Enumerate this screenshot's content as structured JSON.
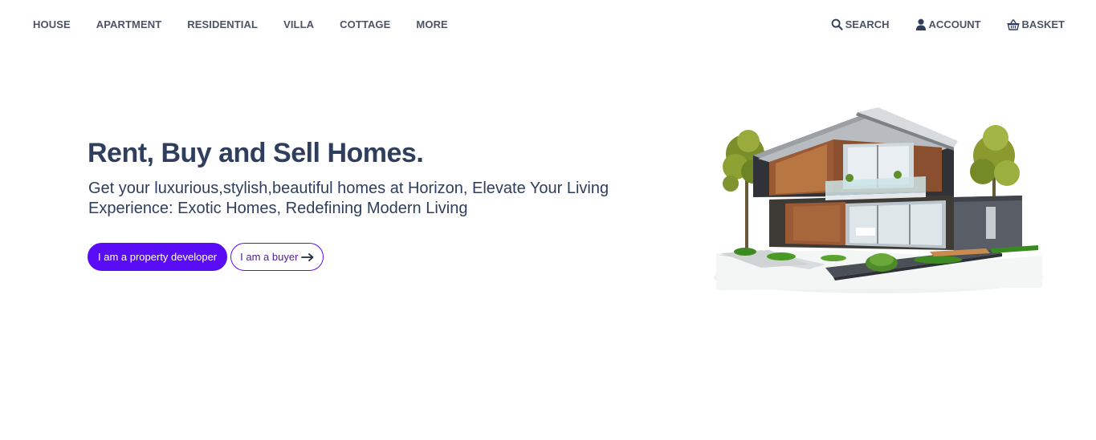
{
  "nav": {
    "links": [
      {
        "label": "HOUSE"
      },
      {
        "label": "APARTMENT"
      },
      {
        "label": "RESIDENTIAL"
      },
      {
        "label": "VILLA"
      },
      {
        "label": "COTTAGE"
      },
      {
        "label": "MORE"
      }
    ],
    "utilities": {
      "search": {
        "label": "SEARCH",
        "icon": "search-icon"
      },
      "account": {
        "label": "ACCOUNT",
        "icon": "user-icon"
      },
      "basket": {
        "label": "BASKET",
        "icon": "basket-icon"
      }
    }
  },
  "hero": {
    "title": "Rent, Buy and Sell Homes.",
    "subtitle": "Get your luxurious,stylish,beautiful homes at Horizon, Elevate Your Living Experience: Exotic Homes, Redefining Modern Living",
    "primary_button": "I am a property developer",
    "secondary_button": "I am a buyer",
    "secondary_icon": "arrow-right-icon"
  },
  "colors": {
    "accent": "#5b0cf6",
    "heading": "#2e3e5c",
    "nav_text": "#4b5563"
  }
}
